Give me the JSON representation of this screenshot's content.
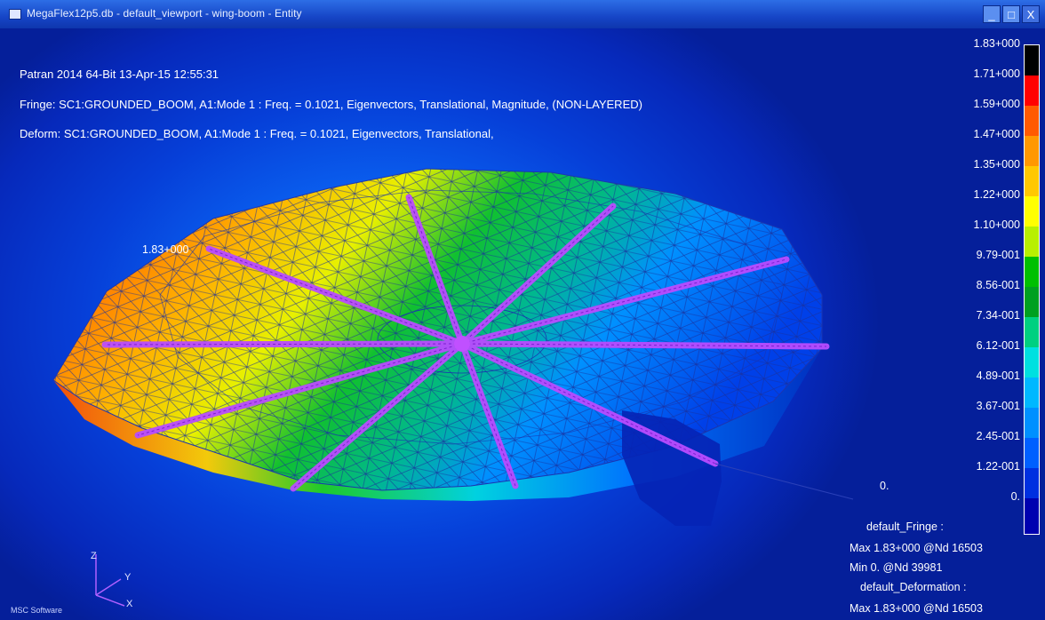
{
  "window": {
    "title": "MegaFlex12p5.db - default_viewport - wing-boom - Entity",
    "buttons": {
      "minimize": "_",
      "maximize": "□",
      "close": "X"
    }
  },
  "header": {
    "line1": "Patran 2014 64-Bit 13-Apr-15 12:55:31",
    "line2": "Fringe: SC1:GROUNDED_BOOM, A1:Mode 1 : Freq. = 0.1021, Eigenvectors, Translational, Magnitude, (NON-LAYERED)",
    "line3": "Deform: SC1:GROUNDED_BOOM, A1:Mode 1 : Freq. = 0.1021, Eigenvectors, Translational,"
  },
  "annotations": {
    "max_label": "1.83+000",
    "zero_label": "0."
  },
  "legend": {
    "ticks": [
      "1.83+000",
      "1.71+000",
      "1.59+000",
      "1.47+000",
      "1.35+000",
      "1.22+000",
      "1.10+000",
      "9.79-001",
      "8.56-001",
      "7.34-001",
      "6.12-001",
      "4.89-001",
      "3.67-001",
      "2.45-001",
      "1.22-001",
      "0."
    ],
    "colors": [
      "#000000",
      "#ff0000",
      "#ff5a00",
      "#ff9800",
      "#ffc800",
      "#ffff00",
      "#b8f000",
      "#00c000",
      "#00a020",
      "#00d080",
      "#00e0e0",
      "#00b8ff",
      "#0090ff",
      "#0060ff",
      "#0030e0",
      "#0000b0"
    ]
  },
  "stats": {
    "fringe_title": "default_Fringe :",
    "fringe_max": "Max 1.83+000 @Nd 16503",
    "fringe_min": "Min 0. @Nd 39981",
    "deform_title": "default_Deformation :",
    "deform_max": "Max 1.83+000 @Nd 16503"
  },
  "axes": {
    "z": "Z",
    "y": "Y",
    "x": "X"
  },
  "brand": "MSC Software"
}
